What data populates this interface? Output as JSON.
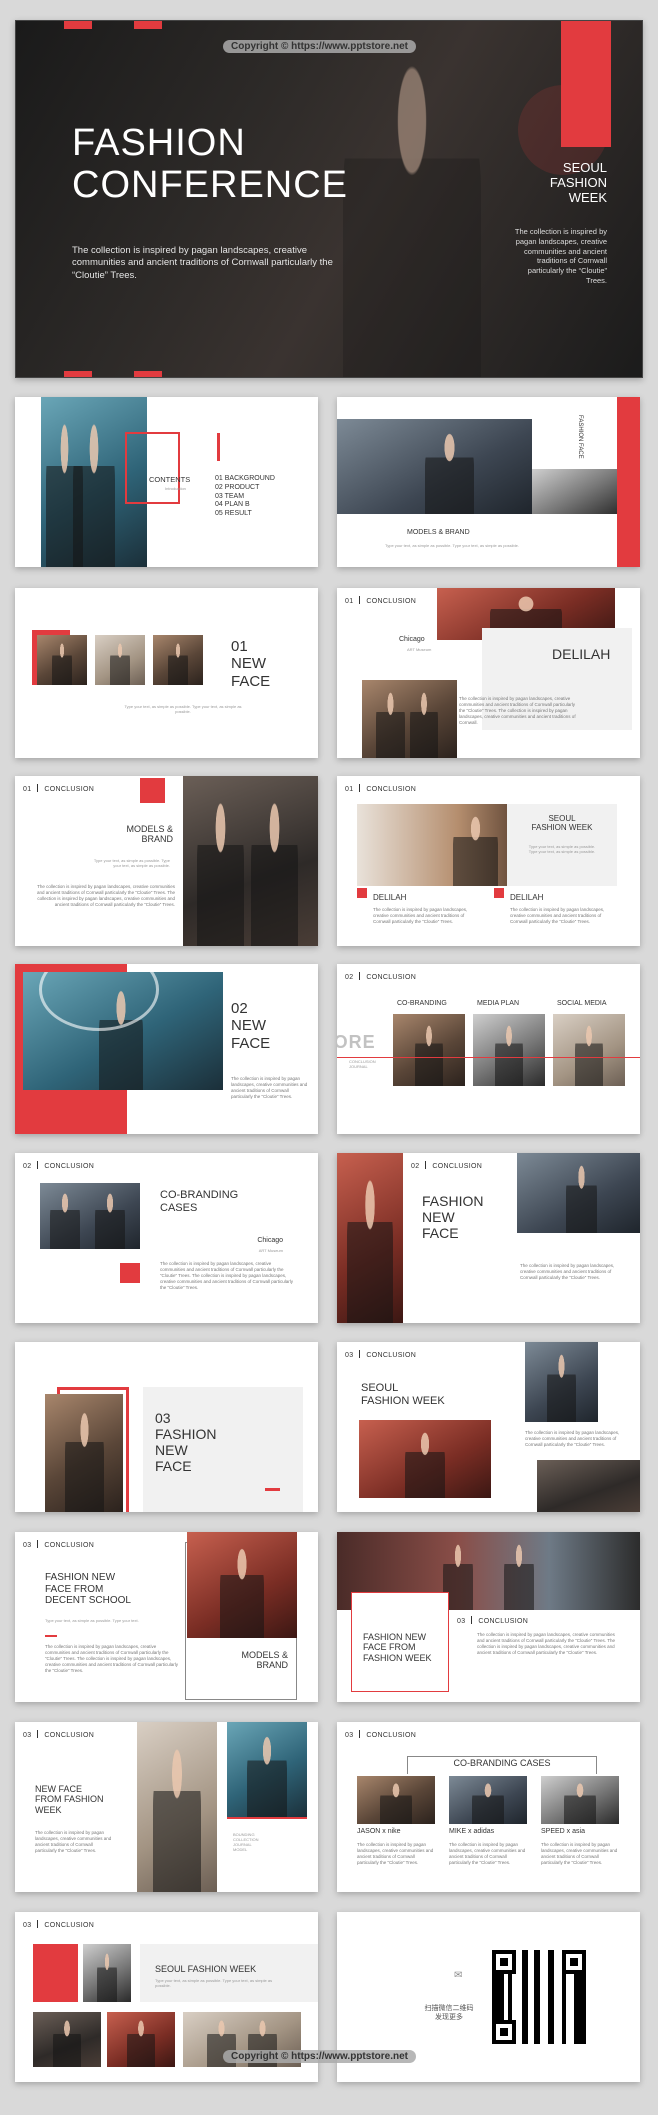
{
  "watermark": {
    "top": "Copyright © https://www.pptstore.net",
    "bottom": "Copyright © https://www.pptstore.net"
  },
  "cover": {
    "title": "FASHION\nCONFERENCE",
    "subtitle": "The collection is inspired by pagan landscapes, creative communities and ancient traditions of Cornwall particularly the “Cloutie” Trees.",
    "side_title": "SEOUL\nFASHION\nWEEK",
    "side_text": "The collection is inspired by pagan landscapes, creative communities and ancient traditions of Cornwall particularly the “Cloutie” Trees."
  },
  "s_contents": {
    "label": "CONTENTS",
    "sublabel": "Introduction",
    "items": [
      "01 BACKGROUND",
      "02 PRODUCT",
      "03 TEAM",
      "04 PLAN B",
      "05 RESULT"
    ]
  },
  "s_models": {
    "side": "FASHION FACE",
    "caption": "MODELS & BRAND",
    "text": "Type your text, as simple as possible. Type your text, as simple as possible."
  },
  "s_newface1": {
    "title": "01\nNEW\nFACE",
    "text": "Type your text, as simple as possible. Type your text, as simple as possible."
  },
  "s_chicago": {
    "hdr_num": "01",
    "hdr_label": "CONCLUSION",
    "city": "Chicago",
    "city_sub": "ART Museum",
    "name": "DELILAH",
    "text": "The collection is inspired by pagan landscapes, creative communities and ancient traditions of Cornwall particularly the “Cloutie” Trees. The collection is inspired by pagan landscapes, creative communities and ancient traditions of Cornwall."
  },
  "s_models2": {
    "hdr_num": "01",
    "hdr_label": "CONCLUSION",
    "title": "MODELS &\nBRAND",
    "sub": "Type your text, as simple as possible. Type your text, as simple as possible.",
    "text": "The collection is inspired by pagan landscapes, creative communities and ancient traditions of Cornwall particularly the “Cloutie” Trees. The collection is inspired by pagan landscapes, creative communities and ancient traditions of Cornwall particularly the “Cloutie” Trees."
  },
  "s_seoul1": {
    "hdr_num": "01",
    "hdr_label": "CONCLUSION",
    "title": "SEOUL\nFASHION WEEK",
    "sub": "Type your text, as simple as possible. Type your text, as simple as possible.",
    "name1": "DELILAH",
    "name2": "DELILAH",
    "text1": "The collection is inspired by pagan landscapes, creative communities and ancient traditions of Cornwall particularly the “Cloutie” Trees.",
    "text2": "The collection is inspired by pagan landscapes, creative communities and ancient traditions of Cornwall particularly the “Cloutie” Trees."
  },
  "s_newface2": {
    "title": "02\nNEW\nFACE",
    "text": "The collection is inspired by pagan landscapes, creative communities and ancient traditions of Cornwall particularly the “Cloutie” Trees."
  },
  "s_cobrand": {
    "hdr_num": "02",
    "hdr_label": "CONCLUSION",
    "cols": [
      "CO-BRANDING",
      "MEDIA PLAN",
      "SOCIAL MEDIA"
    ],
    "side_label": "CONCLUSION JOURNAL",
    "wm": "PPTSTORE"
  },
  "s_cases": {
    "hdr_num": "02",
    "hdr_label": "CONCLUSION",
    "title": "CO-BRANDING\nCASES",
    "city": "Chicago",
    "city_sub": "ART Museum",
    "text": "The collection is inspired by pagan landscapes, creative communities and ancient traditions of Cornwall particularly the “Cloutie” Trees. The collection is inspired by pagan landscapes, creative communities and ancient traditions of Cornwall particularly the “Cloutie” Trees."
  },
  "s_fnf": {
    "hdr_num": "02",
    "hdr_label": "CONCLUSION",
    "title": "FASHION\nNEW\nFACE",
    "text": "The collection is inspired by pagan landscapes, creative communities and ancient traditions of Cornwall particularly the “Cloutie” Trees."
  },
  "s_03fnf": {
    "title": "03\nFASHION\nNEW\nFACE"
  },
  "s_seoul2": {
    "hdr_num": "03",
    "hdr_label": "CONCLUSION",
    "title": "SEOUL\nFASHION WEEK",
    "text": "The collection is inspired by pagan landscapes, creative communities and ancient traditions of Cornwall particularly the “Cloutie” Trees."
  },
  "s_decent": {
    "hdr_num": "03",
    "hdr_label": "CONCLUSION",
    "title": "FASHION NEW\nFACE FROM\nDECENT SCHOOL",
    "sub": "Type your text, as simple as possible. Type your text.",
    "text": "The collection is inspired by pagan landscapes, creative communities and ancient traditions of Cornwall particularly the “Cloutie” Trees. The collection is inspired by pagan landscapes, creative communities and ancient traditions of Cornwall particularly the “Cloutie” Trees.",
    "caption": "MODELS &\nBRAND"
  },
  "s_fnfweek": {
    "hdr_num": "03",
    "hdr_label": "CONCLUSION",
    "title": "FASHION NEW\nFACE FROM\nFASHION WEEK",
    "text": "The collection is inspired by pagan landscapes, creative communities and ancient traditions of Cornwall particularly the “Cloutie” Trees. The collection is inspired by pagan landscapes, creative communities and ancient traditions of Cornwall particularly the “Cloutie” Trees."
  },
  "s_nffw": {
    "hdr_num": "03",
    "hdr_label": "CONCLUSION",
    "title": "NEW FACE\nFROM FASHION\nWEEK",
    "text": "The collection is inspired by pagan landscapes, creative communities and ancient traditions of Cornwall particularly the “Cloutie” Trees.",
    "side_text": "BOUNDING\nCOLLECTION\nJOURNAL\nMODEL"
  },
  "s_cases2": {
    "hdr_num": "03",
    "hdr_label": "CONCLUSION",
    "title": "CO-BRANDING CASES",
    "brands": [
      "JASON x nike",
      "MIKE x adidas",
      "SPEED x asia"
    ],
    "text": "The collection is inspired by pagan landscapes, creative communities and ancient traditions of Cornwall particularly the “Cloutie” Trees."
  },
  "s_final": {
    "hdr_num": "03",
    "hdr_label": "CONCLUSION",
    "title": "SEOUL FASHION WEEK",
    "sub": "Type your text, as simple as possible. Type your text, as simple as possible."
  },
  "s_qr": {
    "text": "扫描微信二维码\n发现更多"
  }
}
